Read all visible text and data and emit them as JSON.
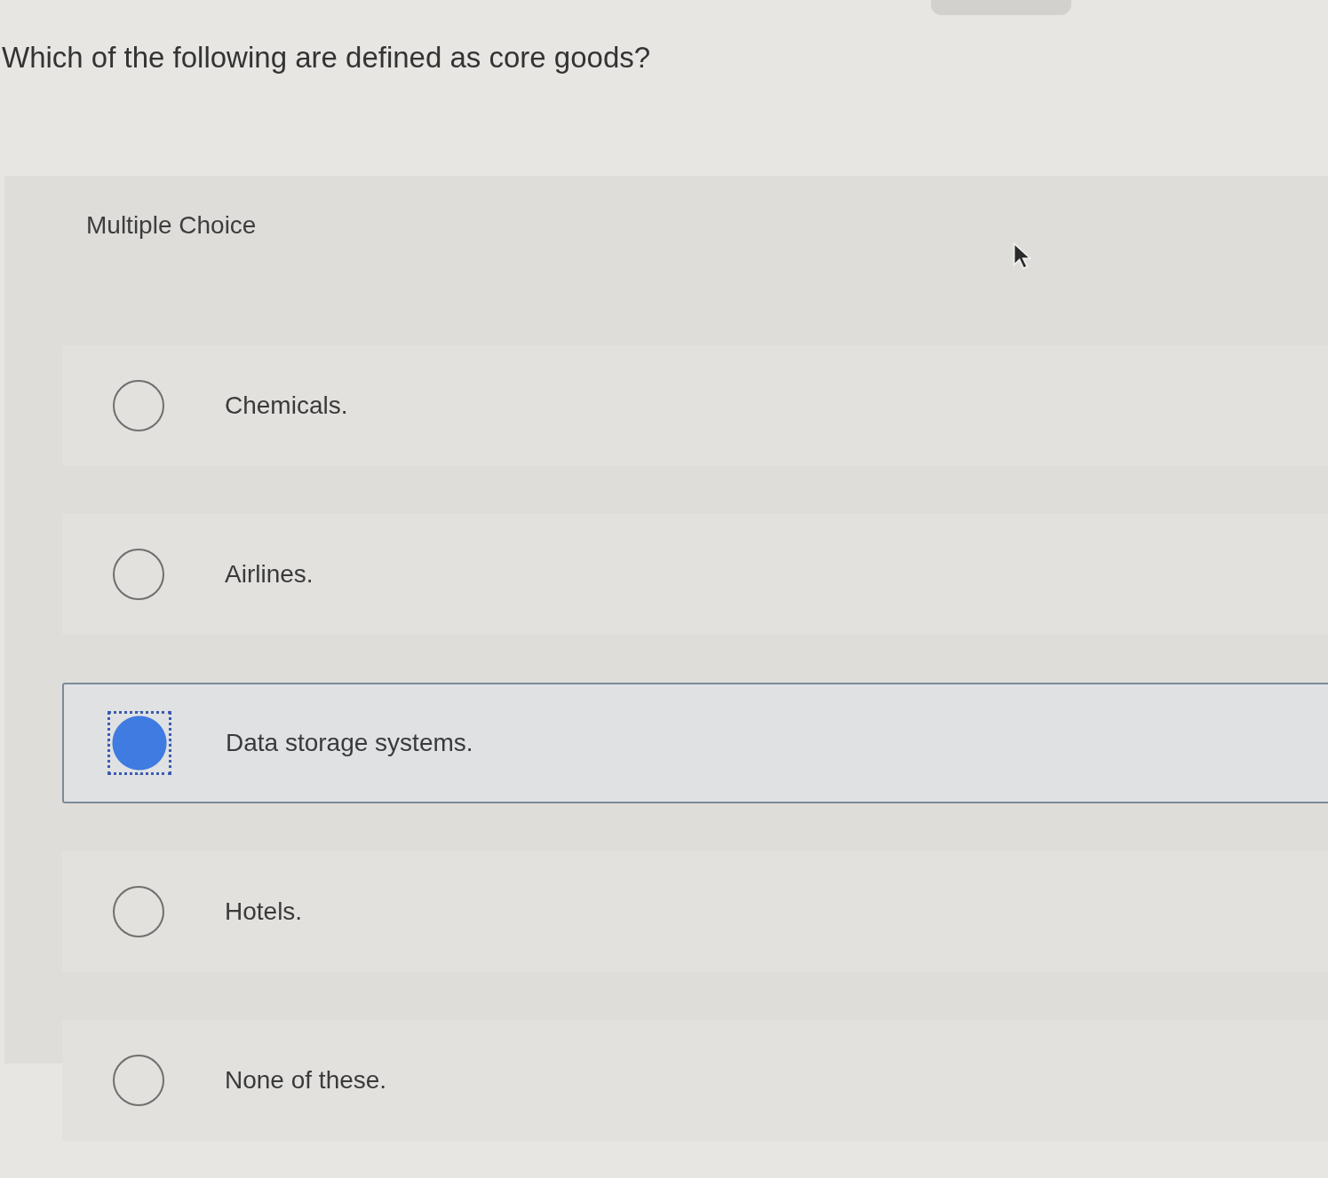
{
  "question": "Which of the following are defined as core goods?",
  "panel": {
    "heading": "Multiple Choice",
    "options": [
      {
        "label": "Chemicals.",
        "selected": false
      },
      {
        "label": "Airlines.",
        "selected": false
      },
      {
        "label": "Data storage systems.",
        "selected": true
      },
      {
        "label": "Hotels.",
        "selected": false
      },
      {
        "label": "None of these.",
        "selected": false
      }
    ]
  }
}
